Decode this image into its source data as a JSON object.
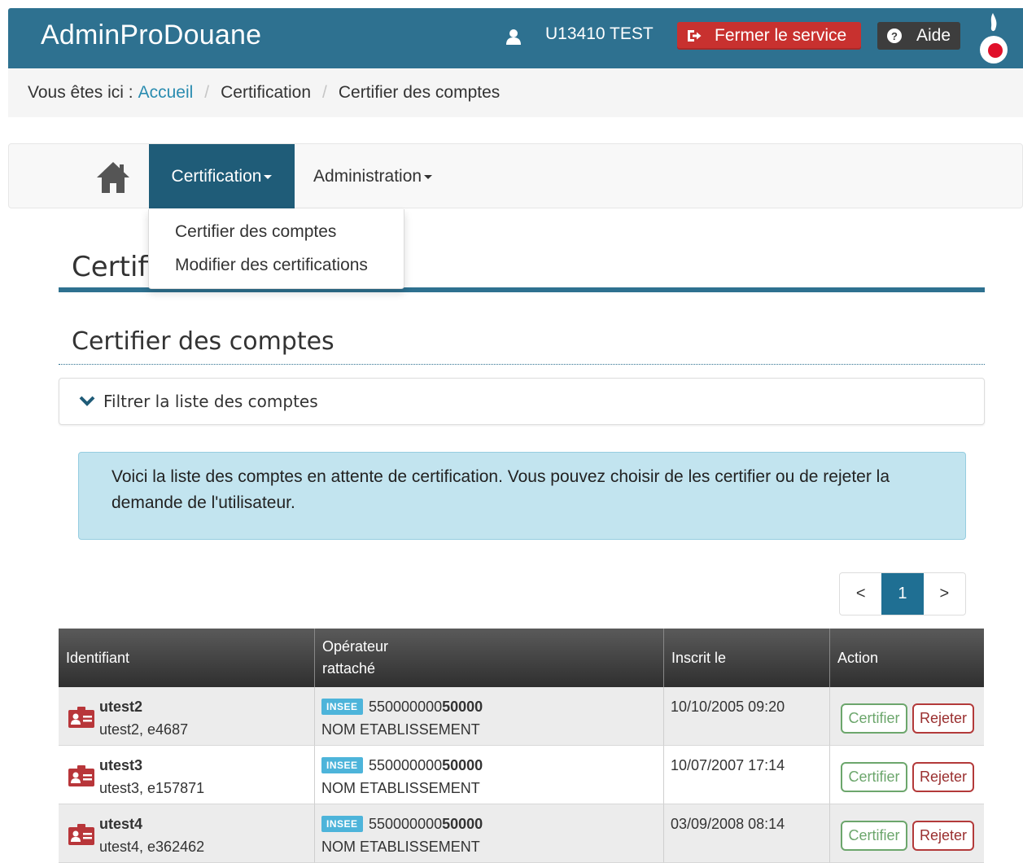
{
  "header": {
    "title": "AdminProDouane",
    "user": "U13410 TEST",
    "close_label": "Fermer le service",
    "help_label": "Aide"
  },
  "breadcrumb": {
    "prefix": "Vous êtes ici :",
    "home": "Accueil",
    "level2": "Certification",
    "level3": "Certifier des comptes"
  },
  "nav": {
    "certification": "Certification",
    "administration": "Administration",
    "dropdown": [
      "Certifier des comptes",
      "Modifier des certifications"
    ]
  },
  "page": {
    "title": "Certifi",
    "subtitle": "Certifier des comptes",
    "filter_label": "Filtrer la liste des comptes",
    "info_text": "Voici la liste des comptes en attente de certification. Vous pouvez choisir de les certifier ou de rejeter la demande de l'utilisateur."
  },
  "pager": {
    "prev": "<",
    "current": "1",
    "next": ">"
  },
  "table": {
    "headers": {
      "id": "Identifiant",
      "op_line1": "Opérateur",
      "op_line2": "rattaché",
      "date": "Inscrit le",
      "action": "Action"
    },
    "badge": "INSEE",
    "certify_label": "Certifier",
    "reject_label": "Rejeter",
    "rows": [
      {
        "login": "utest2",
        "detail": "utest2, e4687",
        "siret_a": "550000000",
        "siret_b": "50000",
        "etab": "NOM ETABLISSEMENT",
        "date": "10/10/2005 09:20"
      },
      {
        "login": "utest3",
        "detail": "utest3, e157871",
        "siret_a": "550000000",
        "siret_b": "50000",
        "etab": "NOM ETABLISSEMENT",
        "date": "10/07/2007 17:14"
      },
      {
        "login": "utest4",
        "detail": "utest4, e362462",
        "siret_a": "550000000",
        "siret_b": "50000",
        "etab": "NOM ETABLISSEMENT",
        "date": "03/09/2008 08:14"
      }
    ]
  },
  "colors": {
    "header_bg": "#2e7190",
    "close_btn": "#c8312f",
    "help_btn": "#3d3d3d",
    "nav_active": "#1f5c78",
    "link": "#2a8cb0",
    "alert_bg": "#c2e4ef",
    "certify": "#6ca66c",
    "reject": "#b33a3a",
    "badge": "#4db4da"
  },
  "icons": [
    "user-icon",
    "logout-icon",
    "help-icon",
    "logo-icon",
    "home-icon",
    "chevron-down-icon",
    "id-card-icon"
  ]
}
